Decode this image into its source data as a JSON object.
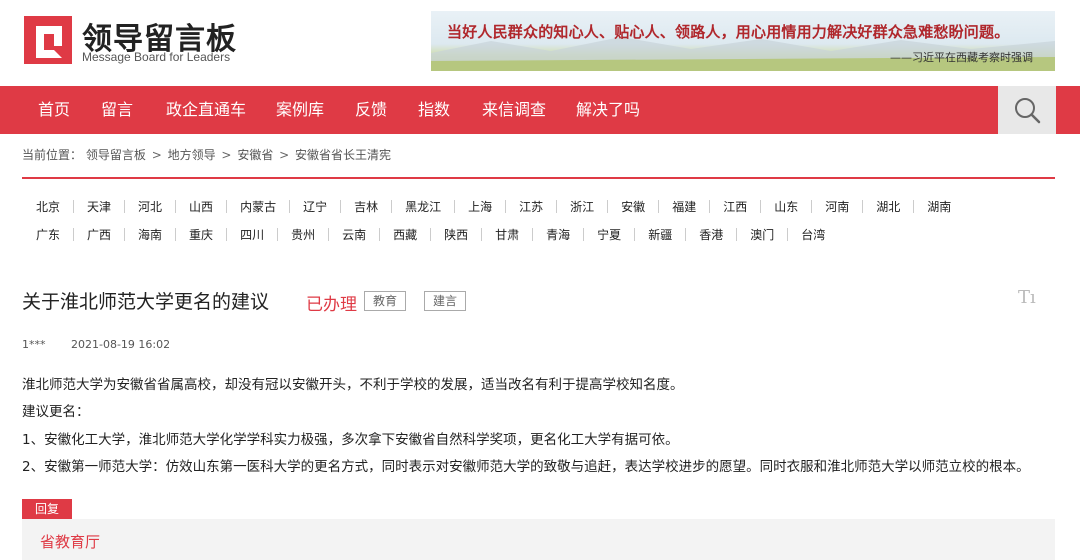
{
  "site": {
    "title": "领导留言板",
    "subtitle": "Message Board for Leaders",
    "brand_color": "#df3a45"
  },
  "banner": {
    "quote": "当好人民群众的知心人、贴心人、领路人，用心用情用力解决好群众急难愁盼问题。",
    "source": "——习近平在西藏考察时强调"
  },
  "nav": {
    "items": [
      "首页",
      "留言",
      "政企直通车",
      "案例库",
      "反馈",
      "指数",
      "来信调查",
      "解决了吗"
    ],
    "search_icon": "search-icon"
  },
  "breadcrumb": {
    "prefix": "当前位置：",
    "items": [
      "领导留言板",
      "地方领导",
      "安徽省",
      "安徽省省长王清宪"
    ],
    "separator": ">"
  },
  "regions": {
    "row1": [
      "北京",
      "天津",
      "河北",
      "山西",
      "内蒙古",
      "辽宁",
      "吉林",
      "黑龙江",
      "上海",
      "江苏",
      "浙江",
      "安徽",
      "福建",
      "江西",
      "山东",
      "河南",
      "湖北",
      "湖南"
    ],
    "row2": [
      "广东",
      "广西",
      "海南",
      "重庆",
      "四川",
      "贵州",
      "云南",
      "西藏",
      "陕西",
      "甘肃",
      "青海",
      "宁夏",
      "新疆",
      "香港",
      "澳门",
      "台湾"
    ]
  },
  "article": {
    "title": "关于淮北师范大学更名的建议",
    "status": "已办理",
    "tags": [
      "教育",
      "建言"
    ],
    "font_tool": "Tı",
    "author": "1***",
    "date": "2021-08-19 16:02",
    "body": [
      "淮北师范大学为安徽省省属高校，却没有冠以安徽开头，不利于学校的发展，适当改名有利于提高学校知名度。",
      "建议更名：",
      "1、安徽化工大学，淮北师范大学化学学科实力极强，多次拿下安徽省自然科学奖项，更名化工大学有据可依。",
      "2、安徽第一师范大学：仿效山东第一医科大学的更名方式，同时表示对安徽师范大学的致敬与追赶，表达学校进步的愿望。同时衣服和淮北师范大学以师范立校的根本。"
    ]
  },
  "reply": {
    "label": "回复",
    "org": "省教育厅"
  }
}
